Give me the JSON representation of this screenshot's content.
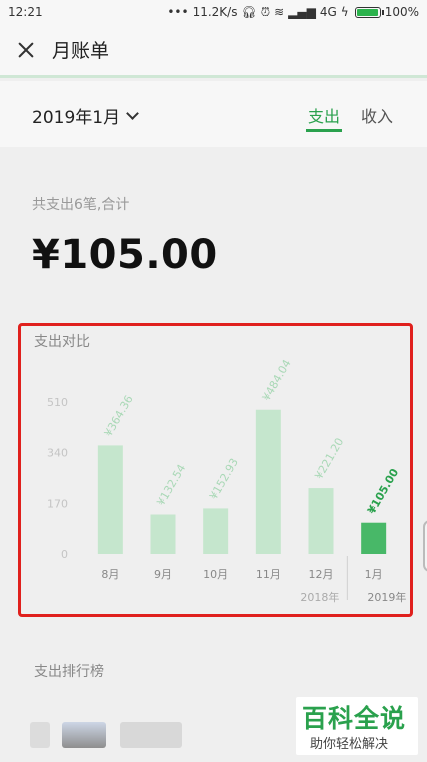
{
  "status_bar": {
    "time": "12:21",
    "dots": "•••",
    "speed": "11.2K/s",
    "network": "4G",
    "battery": "100%",
    "battery_level": 1.0
  },
  "header": {
    "title": "月账单"
  },
  "filter": {
    "month": "2019年1月",
    "tabs": [
      {
        "label": "支出",
        "active": true
      },
      {
        "label": "收入",
        "active": false
      }
    ]
  },
  "summary": {
    "label": "共支出6笔,合计",
    "amount": "¥105.00"
  },
  "chart_section": {
    "title": "支出对比"
  },
  "chart_data": {
    "type": "bar",
    "categories": [
      "8月",
      "9月",
      "10月",
      "11月",
      "12月",
      "1月"
    ],
    "values": [
      364.36,
      132.54,
      152.93,
      484.04,
      221.2,
      105.0
    ],
    "data_labels": [
      "¥364.36",
      "¥132.54",
      "¥152.93",
      "¥484.04",
      "¥221.20",
      "¥105.00"
    ],
    "y_ticks": [
      "510",
      "340",
      "170",
      "0"
    ],
    "ylim": [
      0,
      510
    ],
    "year_labels": [
      "2018年",
      "2019年"
    ],
    "highlight_index": 5,
    "colors": {
      "bar": "#c5e6cd",
      "highlight": "#48b868",
      "label": "#a9d8b6",
      "highlight_label": "#2aa14d"
    }
  },
  "ranking": {
    "title": "支出排行榜"
  },
  "watermark": {
    "logo": "百科全说",
    "tagline": "助你轻松解决"
  }
}
